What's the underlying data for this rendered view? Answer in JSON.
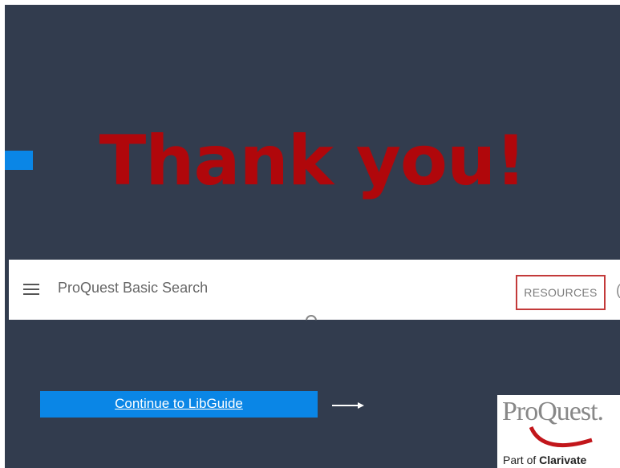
{
  "slide": {
    "title": "Thank you!",
    "accent_color": "#0a86e6",
    "title_color": "#b0070b",
    "background": "#323c4e"
  },
  "searchbar": {
    "menu_icon": "hamburger-menu-icon",
    "label": "ProQuest Basic Search",
    "resources_button": "RESOURCES",
    "loading_icon": "spinner-icon"
  },
  "libguide": {
    "label": "Continue to LibGuide",
    "arrow_icon": "arrow-right-icon"
  },
  "logo": {
    "wordmark": "ProQuest.",
    "sub_prefix": "Part of ",
    "sub_brand": "Clarivate"
  }
}
